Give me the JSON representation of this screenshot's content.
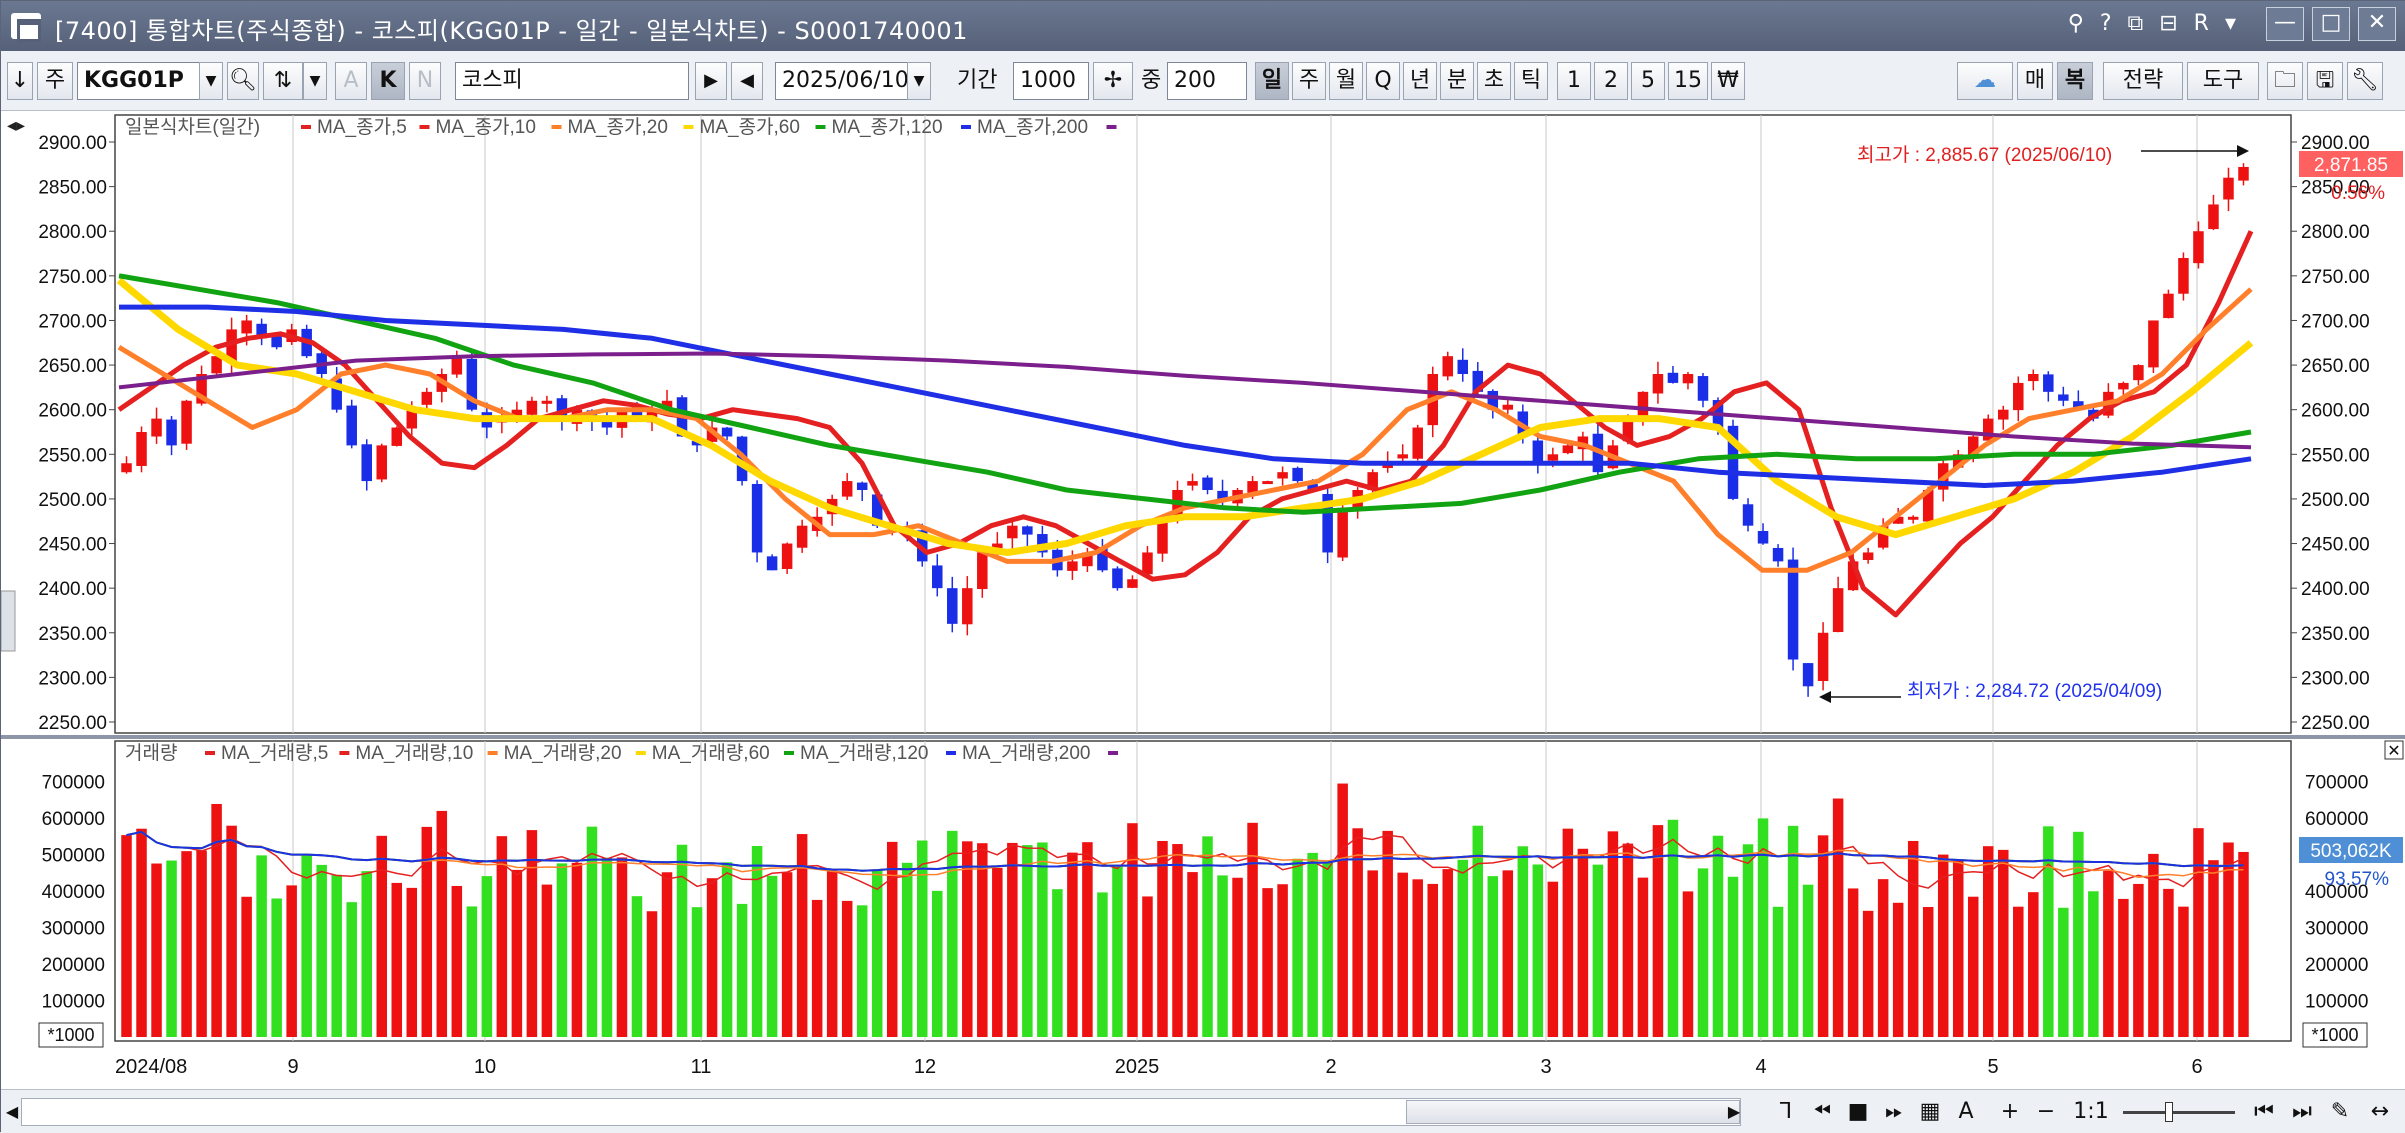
{
  "window": {
    "title": "[7400]  통합차트(주식종합) - 코스피(KGG01P - 일간 - 일본식차트) - S0001740001",
    "title_icons": [
      "?",
      "R"
    ]
  },
  "toolbar": {
    "code_type": "주",
    "symbol_code": "KGG01P",
    "symbol_name": "코스피",
    "date": "2025/06/10",
    "period_label": "기간",
    "period_value": "1000",
    "count_label": "중",
    "count_value": "200",
    "mode_a": "A",
    "mode_k": "K",
    "mode_n": "N",
    "intervals": [
      "일",
      "주",
      "월",
      "Q",
      "년",
      "분",
      "초",
      "틱",
      "1",
      "2",
      "5",
      "15",
      "₩"
    ],
    "buy_label": "매",
    "dup_label": "복",
    "strategy_label": "전략",
    "tools_label": "도구"
  },
  "price_panel": {
    "legend_title": "일본식차트(일간)",
    "ma_labels": [
      "MA_종가,5",
      "MA_종가,10",
      "MA_종가,20",
      "MA_종가,60",
      "MA_종가,120",
      "MA_종가,200"
    ],
    "ma_colors": [
      "#e52020",
      "#e52020",
      "#ff7f2a",
      "#ffd800",
      "#12a312",
      "#1e2fe6",
      "#7a1f8c"
    ],
    "y_ticks": [
      "2900.00",
      "2850.00",
      "2800.00",
      "2750.00",
      "2700.00",
      "2650.00",
      "2600.00",
      "2550.00",
      "2500.00",
      "2450.00",
      "2400.00",
      "2350.00",
      "2300.00",
      "2250.00"
    ],
    "right_ticks": [
      "2900.00",
      "2850.00",
      "2800.00",
      "2750.00",
      "2700.00",
      "2650.00",
      "2600.00",
      "2550.00",
      "2500.00",
      "2450.00",
      "2400.00",
      "2350.00",
      "2300.00",
      "2250.00"
    ],
    "high_annotation": "최고가 : 2,885.67 (2025/06/10)",
    "low_annotation": "최저가 : 2,284.72 (2025/04/09)",
    "current_price": "2,871.85",
    "change_pct": "0.56%"
  },
  "volume_panel": {
    "legend_title": "거래량",
    "ma_labels": [
      "MA_거래량,5",
      "MA_거래량,10",
      "MA_거래량,20",
      "MA_거래량,60",
      "MA_거래량,120",
      "MA_거래량,200"
    ],
    "y_ticks": [
      "700000",
      "600000",
      "500000",
      "400000",
      "300000",
      "200000",
      "100000"
    ],
    "unit_label": "*1000",
    "current_volume": "503,062K",
    "volume_pct": "93.57%"
  },
  "x_axis": {
    "labels": [
      "2024/08",
      "9",
      "10",
      "11",
      "12",
      "2025",
      "2",
      "3",
      "4",
      "5",
      "6"
    ]
  },
  "bottom": {
    "ratio_label": "1:1"
  },
  "chart_data": {
    "type": "candlestick",
    "title": "일본식차트(일간)",
    "y_range": [
      2250,
      2900
    ],
    "volume_range": [
      0,
      750000
    ],
    "high": {
      "value": 2885.67,
      "date": "2025/06/10"
    },
    "low": {
      "value": 2284.72,
      "date": "2025/04/09"
    },
    "last_close": 2871.85,
    "months": [
      "2024/08",
      "2024/09",
      "2024/10",
      "2024/11",
      "2024/12",
      "2025/01",
      "2025/02",
      "2025/03",
      "2025/04",
      "2025/05",
      "2025/06"
    ],
    "close_series": [
      2540,
      2575,
      2590,
      2560,
      2610,
      2640,
      2660,
      2690,
      2700,
      2680,
      2670,
      2690,
      2660,
      2640,
      2600,
      2560,
      2520,
      2560,
      2580,
      2600,
      2620,
      2640,
      2660,
      2600,
      2580,
      2590,
      2600,
      2610,
      2610,
      2590,
      2600,
      2590,
      2580,
      2600,
      2590,
      2600,
      2610,
      2570,
      2560,
      2580,
      2570,
      2520,
      2440,
      2420,
      2450,
      2470,
      2480,
      2500,
      2520,
      2510,
      2470,
      2470,
      2460,
      2430,
      2400,
      2360,
      2400,
      2440,
      2450,
      2470,
      2460,
      2440,
      2420,
      2430,
      2440,
      2420,
      2400,
      2410,
      2440,
      2480,
      2510,
      2520,
      2510,
      2500,
      2510,
      2520,
      2520,
      2530,
      2520,
      2510,
      2440,
      2490,
      2510,
      2530,
      2540,
      2550,
      2580,
      2640,
      2660,
      2640,
      2620,
      2600,
      2600,
      2570,
      2540,
      2550,
      2560,
      2570,
      2530,
      2560,
      2590,
      2620,
      2640,
      2630,
      2640,
      2610,
      2580,
      2500,
      2470,
      2450,
      2430,
      2320,
      2290,
      2350,
      2400,
      2430,
      2440,
      2470,
      2480,
      2480,
      2510,
      2540,
      2550,
      2570,
      2590,
      2600,
      2630,
      2640,
      2620,
      2610,
      2600,
      2590,
      2620,
      2630,
      2650,
      2700,
      2730,
      2770,
      2800,
      2830,
      2860,
      2872
    ],
    "ma5": [
      2600,
      2625,
      2650,
      2670,
      2680,
      2685,
      2675,
      2650,
      2610,
      2570,
      2540,
      2535,
      2560,
      2590,
      2600,
      2610,
      2605,
      2595,
      2590,
      2600,
      2595,
      2590,
      2580,
      2540,
      2470,
      2440,
      2450,
      2470,
      2480,
      2470,
      2450,
      2430,
      2410,
      2415,
      2440,
      2480,
      2500,
      2510,
      2520,
      2510,
      2520,
      2560,
      2620,
      2650,
      2640,
      2610,
      2580,
      2560,
      2570,
      2590,
      2620,
      2630,
      2600,
      2490,
      2400,
      2370,
      2410,
      2450,
      2480,
      2520,
      2560,
      2590,
      2610,
      2620,
      2650,
      2720,
      2800
    ],
    "ma20": [
      2670,
      2640,
      2610,
      2580,
      2600,
      2640,
      2650,
      2640,
      2610,
      2590,
      2590,
      2600,
      2600,
      2590,
      2550,
      2500,
      2460,
      2460,
      2470,
      2450,
      2430,
      2430,
      2440,
      2470,
      2490,
      2500,
      2510,
      2520,
      2550,
      2600,
      2620,
      2600,
      2570,
      2560,
      2540,
      2520,
      2460,
      2420,
      2420,
      2440,
      2480,
      2520,
      2560,
      2590,
      2600,
      2610,
      2640,
      2690,
      2735
    ],
    "ma60": [
      2745,
      2690,
      2650,
      2640,
      2620,
      2600,
      2590,
      2590,
      2590,
      2590,
      2560,
      2520,
      2490,
      2470,
      2450,
      2440,
      2450,
      2470,
      2480,
      2480,
      2490,
      2500,
      2520,
      2550,
      2580,
      2590,
      2590,
      2580,
      2520,
      2480,
      2460,
      2480,
      2500,
      2530,
      2570,
      2620,
      2675
    ],
    "ma120": [
      2750,
      2735,
      2720,
      2700,
      2680,
      2650,
      2630,
      2600,
      2580,
      2560,
      2545,
      2530,
      2510,
      2500,
      2490,
      2485,
      2490,
      2495,
      2510,
      2530,
      2545,
      2550,
      2545,
      2545,
      2550,
      2550,
      2560,
      2575
    ],
    "ma200": [
      2715,
      2715,
      2710,
      2700,
      2695,
      2690,
      2680,
      2660,
      2640,
      2620,
      2600,
      2580,
      2560,
      2545,
      2540,
      2540,
      2540,
      2540,
      2530,
      2525,
      2520,
      2515,
      2520,
      2530,
      2545
    ],
    "ma_long": [
      2625,
      2640,
      2655,
      2660,
      2662,
      2663,
      2660,
      2655,
      2648,
      2638,
      2630,
      2620,
      2610,
      2600,
      2590,
      2580,
      2570,
      2562,
      2558
    ]
  }
}
